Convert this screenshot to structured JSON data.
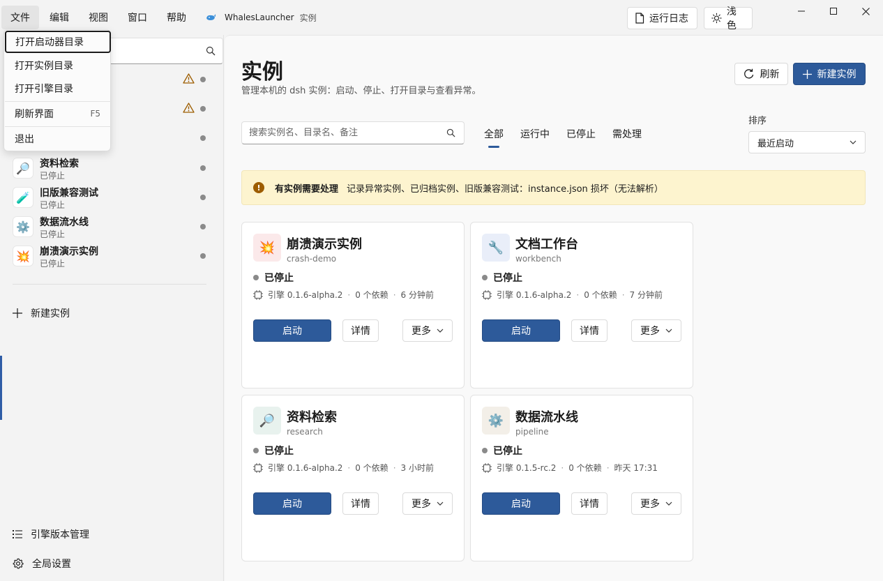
{
  "menubar": {
    "items": [
      "文件",
      "编辑",
      "视图",
      "窗口",
      "帮助"
    ],
    "app_name": "WhalesLauncher",
    "app_section": "实例"
  },
  "toolbar": {
    "log_label": "运行日志",
    "theme_label": "浅色"
  },
  "file_menu": {
    "items": [
      {
        "label": "打开启动器目录"
      },
      {
        "label": "打开实例目录"
      },
      {
        "label": "打开引擎目录"
      },
      {
        "label": "刷新界面",
        "shortcut": "F5"
      },
      {
        "label": "退出"
      }
    ]
  },
  "sidebar": {
    "instances": [
      {
        "name": "资料检索",
        "state": "已停止",
        "icon": "🔎"
      },
      {
        "name": "旧版兼容测试",
        "state": "已停止",
        "icon": "🧪"
      },
      {
        "name": "数据流水线",
        "state": "已停止",
        "icon": "⚙️"
      },
      {
        "name": "崩溃演示实例",
        "state": "已停止",
        "icon": "💥"
      }
    ],
    "new_instance": "新建实例",
    "engine_manager": "引擎版本管理",
    "settings": "全局设置"
  },
  "main": {
    "title": "实例",
    "subtitle": "管理本机的 dsh 实例：启动、停止、打开目录与查看异常。",
    "refresh_label": "刷新",
    "new_label": "新建实例",
    "search_placeholder": "搜索实例名、目录名、备注",
    "tabs": [
      "全部",
      "运行中",
      "已停止",
      "需处理"
    ],
    "sort": {
      "label": "排序",
      "value": "最近启动"
    },
    "alert": {
      "title": "有实例需要处理",
      "message": "记录异常实例、已归档实例、旧版兼容测试：instance.json 损坏（无法解析）"
    }
  },
  "cards": [
    {
      "name": "崩溃演示实例",
      "slug": "crash-demo",
      "status": "已停止",
      "engine": "引擎 0.1.6-alpha.2",
      "deps": "0 个依赖",
      "time": "6 分钟前",
      "icon": "💥",
      "start": "启动",
      "detail": "详情",
      "more": "更多"
    },
    {
      "name": "文档工作台",
      "slug": "workbench",
      "status": "已停止",
      "engine": "引擎 0.1.6-alpha.2",
      "deps": "0 个依赖",
      "time": "7 分钟前",
      "icon": "🔧",
      "start": "启动",
      "detail": "详情",
      "more": "更多"
    },
    {
      "name": "资料检索",
      "slug": "research",
      "status": "已停止",
      "engine": "引擎 0.1.6-alpha.2",
      "deps": "0 个依赖",
      "time": "3 小时前",
      "icon": "🔎",
      "start": "启动",
      "detail": "详情",
      "more": "更多"
    },
    {
      "name": "数据流水线",
      "slug": "pipeline",
      "status": "已停止",
      "engine": "引擎 0.1.5-rc.2",
      "deps": "0 个依赖",
      "time": "昨天 17:31",
      "icon": "⚙️",
      "start": "启动",
      "detail": "详情",
      "more": "更多"
    }
  ],
  "colors": {
    "accent": "#2d5a9a",
    "warning_bg": "#fdf4cf",
    "warning_icon": "#9d5d00"
  }
}
